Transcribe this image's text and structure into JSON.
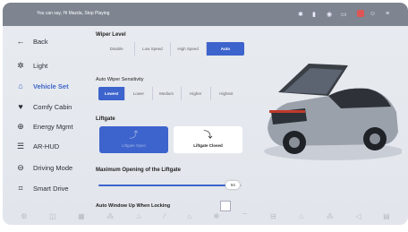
{
  "status_bar": {
    "voice_hint": "You can say, Hi Mazda, Stop Playing"
  },
  "sidebar": {
    "back_label": "Back",
    "items": [
      {
        "label": "Light",
        "icon": "sun-icon"
      },
      {
        "label": "Vehicle Set",
        "icon": "car-outline-icon",
        "active": true
      },
      {
        "label": "Comfy Cabin",
        "icon": "heart-icon"
      },
      {
        "label": "Energy Mgmt",
        "icon": "energy-icon"
      },
      {
        "label": "AR-HUD",
        "icon": "hud-icon"
      },
      {
        "label": "Driving Mode",
        "icon": "steering-wheel-icon"
      },
      {
        "label": "Smart Drive",
        "icon": "smart-drive-icon"
      }
    ]
  },
  "wiper": {
    "title": "Wiper Level",
    "options": [
      "Disable",
      "Low Speed",
      "High Speed",
      "Auto"
    ],
    "selected": "Auto"
  },
  "sensitivity": {
    "title": "Auto Wiper Sensitivity",
    "options": [
      "Lowest",
      "Lower",
      "Medium",
      "Higher",
      "Highest"
    ],
    "selected": "Lowest"
  },
  "liftgate": {
    "title": "Liftgate",
    "open_label": "Liftgate Open",
    "closed_label": "Liftgate Closed"
  },
  "max_opening": {
    "title": "Maximum Opening of the Liftgate",
    "value": 94,
    "display": "94"
  },
  "auto_window": {
    "title": "Auto Window Up When Locking",
    "checked": false
  },
  "colors": {
    "accent": "#3d63cc",
    "active_text": "#3f67c8"
  }
}
